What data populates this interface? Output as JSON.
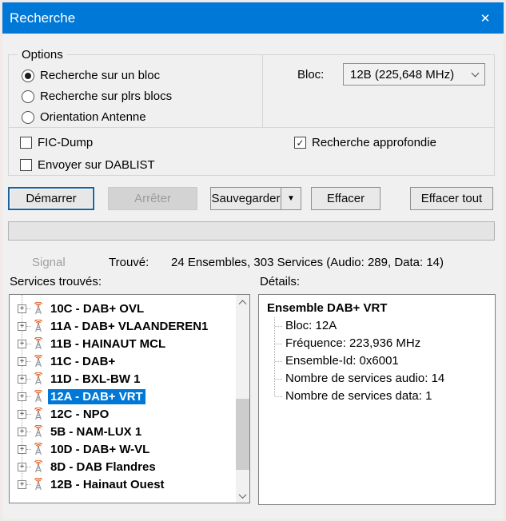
{
  "window": {
    "title": "Recherche",
    "close_glyph": "✕"
  },
  "options": {
    "label": "Options",
    "radios": [
      {
        "label": "Recherche sur un bloc",
        "selected": true
      },
      {
        "label": "Recherche sur plrs blocs",
        "selected": false
      },
      {
        "label": "Orientation Antenne",
        "selected": false
      }
    ],
    "bloc_label": "Bloc:",
    "bloc_value": "12B (225,648 MHz)",
    "checkboxes": [
      {
        "label": "FIC-Dump",
        "checked": false
      },
      {
        "label": "Envoyer sur DABLIST",
        "checked": false
      },
      {
        "label": "Recherche approfondie",
        "checked": true
      }
    ],
    "check_glyph": "✓"
  },
  "buttons": {
    "start": "Démarrer",
    "stop": "Arrêter",
    "save": "Sauvegarder",
    "save_arrow": "▼",
    "clear": "Effacer",
    "clear_all": "Effacer tout"
  },
  "status": {
    "signal": "Signal",
    "found_label": "Trouvé:",
    "found_value": "24 Ensembles, 303 Services (Audio: 289, Data: 14)"
  },
  "services": {
    "label": "Services trouvés:",
    "expander_glyph": "+",
    "items": [
      {
        "label": "10C - DAB+ OVL",
        "selected": false
      },
      {
        "label": "11A - DAB+ VLAANDEREN1",
        "selected": false
      },
      {
        "label": "11B - HAINAUT MCL",
        "selected": false
      },
      {
        "label": "11C - DAB+",
        "selected": false
      },
      {
        "label": "11D - BXL-BW 1",
        "selected": false
      },
      {
        "label": "12A - DAB+ VRT",
        "selected": true
      },
      {
        "label": "12C - NPO",
        "selected": false
      },
      {
        "label": "5B - NAM-LUX 1",
        "selected": false
      },
      {
        "label": "10D - DAB+ W-VL",
        "selected": false
      },
      {
        "label": "8D - DAB Flandres",
        "selected": false
      },
      {
        "label": "12B - Hainaut Ouest",
        "selected": false
      }
    ]
  },
  "details": {
    "label": "Détails:",
    "title": "Ensemble DAB+ VRT",
    "lines": [
      "Bloc: 12A",
      "Fréquence: 223,936 MHz",
      "Ensemble-Id: 0x6001",
      "Nombre de services audio: 14",
      "Nombre de services data: 1"
    ]
  },
  "colors": {
    "titlebar": "#0078d7",
    "selection": "#0078d7",
    "focus_border": "#19649f",
    "antenna_wave": "#e0662a",
    "antenna_tower": "#8a9099"
  }
}
